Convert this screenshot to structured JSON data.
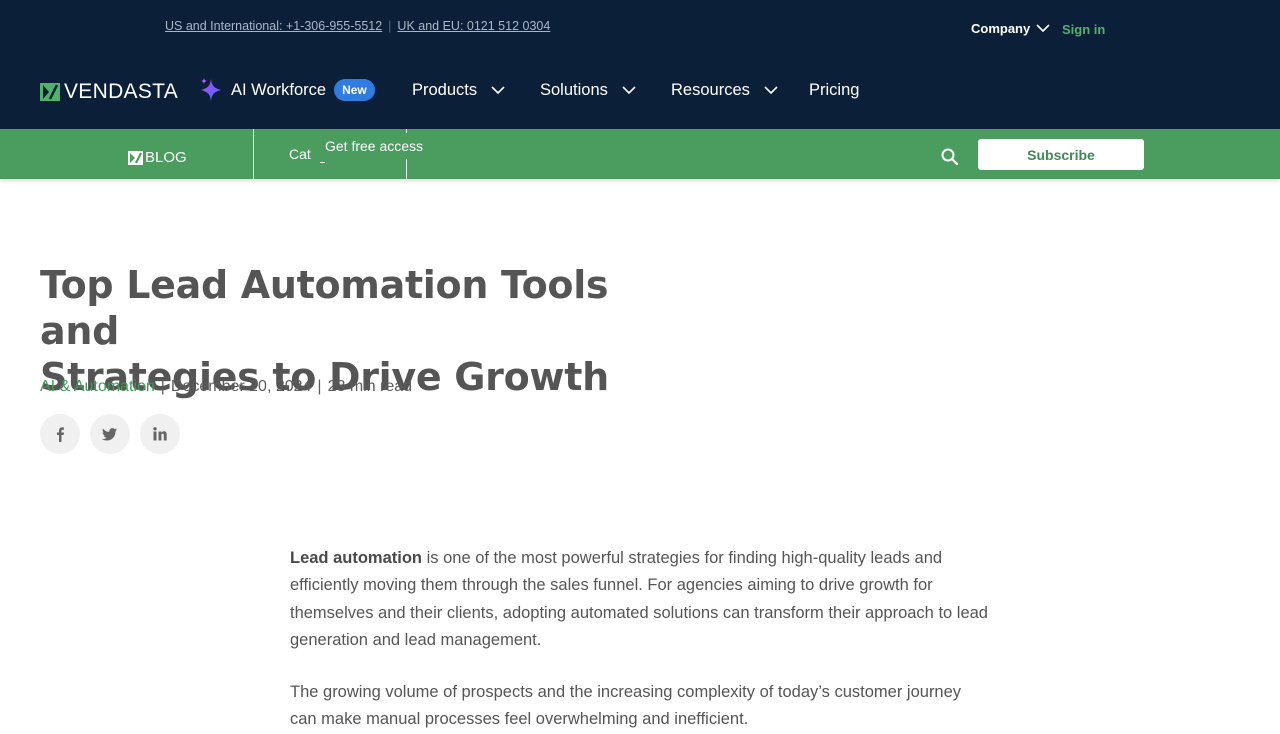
{
  "topbar": {
    "phone_us": "US and International: +1-306-955-5512",
    "phone_separator": "|",
    "phone_uk": "UK and EU: 0121 512 0304",
    "company_label": "Company",
    "signin_label": "Sign in"
  },
  "nav": {
    "logo_text": "VENDASTA",
    "ai_workforce_label": "AI Workforce",
    "new_badge": "New",
    "products_label": "Products",
    "solutions_label": "Solutions",
    "resources_label": "Resources",
    "pricing_label": "Pricing"
  },
  "blogbar": {
    "blog_label": "BLOG",
    "categories_label": "Cat",
    "tooltip": "Get free access",
    "subscribe_label": "Subscribe"
  },
  "article": {
    "title_line1": "Top Lead Automation Tools and",
    "title_line2": "Strategies to Drive Growth",
    "category": "AI & Automation",
    "separator": "|",
    "date": "December 20, 2024",
    "read_time": "23 min read",
    "p1_bold": "Lead automation",
    "p1_rest": " is one of the most powerful strategies for finding high-quality leads and efficiently moving them through the sales funnel. For agencies aiming to drive growth for themselves and their clients, adopting automated solutions can transform their approach to lead generation and lead management.",
    "p2": "The growing volume of prospects and the increasing complexity of today’s customer journey can make manual processes feel overwhelming and inefficient."
  },
  "icons": {
    "logo": "vendasta-logo-icon",
    "ai": "sparkle-icon",
    "chevron": "chevron-down-icon",
    "search": "search-icon",
    "facebook": "facebook-icon",
    "twitter": "twitter-icon",
    "linkedin": "linkedin-icon"
  },
  "colors": {
    "header_bg": "#0c1f38",
    "blogbar_bg": "#4a9d5f",
    "accent_green": "#3e9a57",
    "badge_blue": "#2f7de1"
  }
}
